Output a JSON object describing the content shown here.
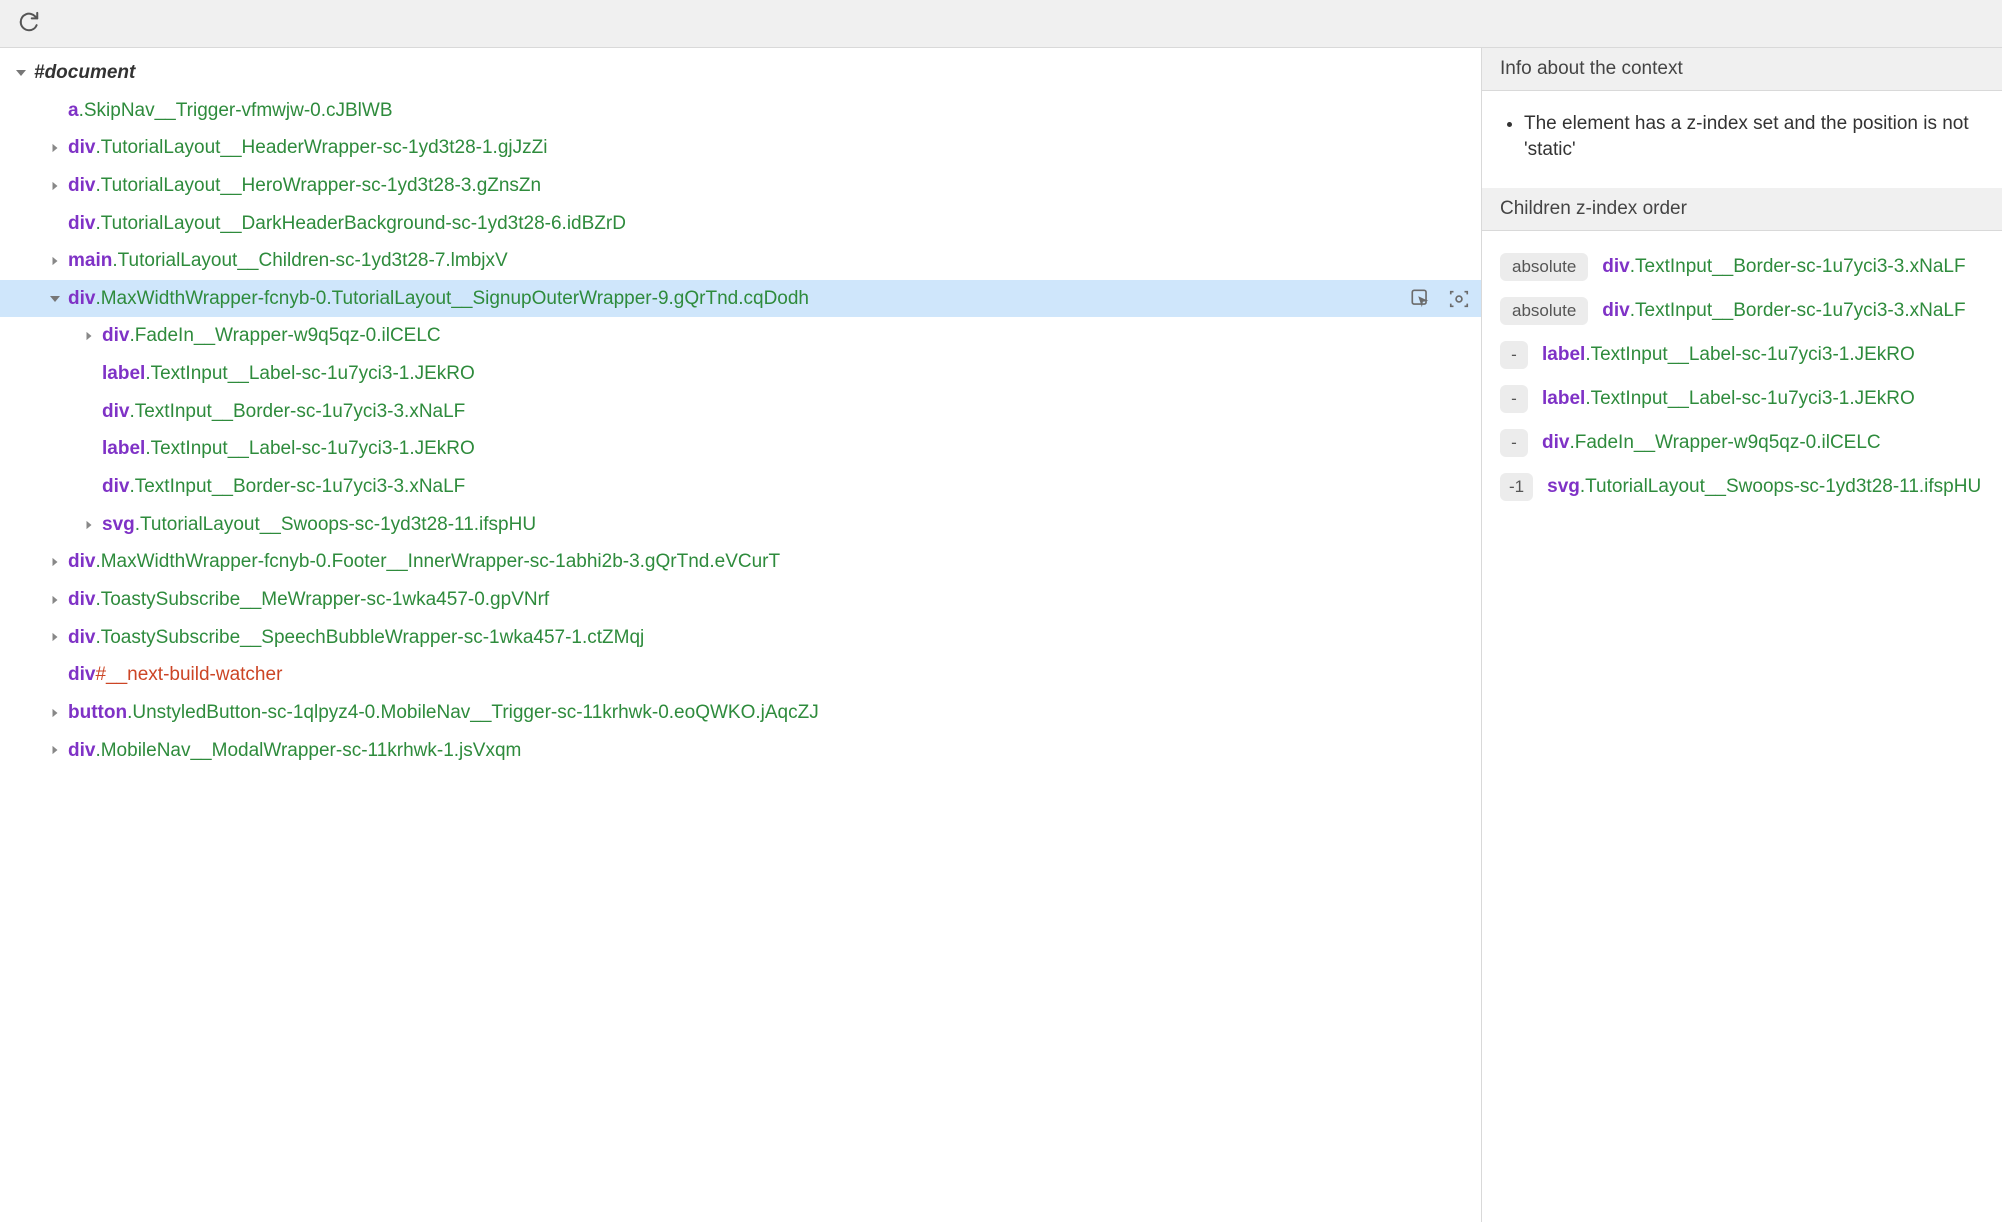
{
  "toolbar": {
    "reload_title": "Reload"
  },
  "tree": {
    "root": {
      "tag": "#document",
      "expanded": true
    },
    "nodes": [
      {
        "id": "a1",
        "depth": 1,
        "arrow": "none",
        "tag": "a",
        "cls": ".SkipNav__Trigger-vfmwjw-0.cJBlWB"
      },
      {
        "id": "d1",
        "depth": 1,
        "arrow": "closed",
        "tag": "div",
        "cls": ".TutorialLayout__HeaderWrapper-sc-1yd3t28-1.gjJzZi"
      },
      {
        "id": "d2",
        "depth": 1,
        "arrow": "closed",
        "tag": "div",
        "cls": ".TutorialLayout__HeroWrapper-sc-1yd3t28-3.gZnsZn"
      },
      {
        "id": "d3",
        "depth": 1,
        "arrow": "none",
        "tag": "div",
        "cls": ".TutorialLayout__DarkHeaderBackground-sc-1yd3t28-6.idBZrD"
      },
      {
        "id": "m1",
        "depth": 1,
        "arrow": "closed",
        "tag": "main",
        "cls": ".TutorialLayout__Children-sc-1yd3t28-7.lmbjxV"
      },
      {
        "id": "d4",
        "depth": 1,
        "arrow": "open",
        "tag": "div",
        "cls": ".MaxWidthWrapper-fcnyb-0.TutorialLayout__SignupOuterWrapper-9.gQrTnd.cqDodh",
        "selected": true
      },
      {
        "id": "d4a",
        "depth": 2,
        "arrow": "closed",
        "tag": "div",
        "cls": ".FadeIn__Wrapper-w9q5qz-0.ilCELC"
      },
      {
        "id": "d4b",
        "depth": 2,
        "arrow": "none",
        "tag": "label",
        "cls": ".TextInput__Label-sc-1u7yci3-1.JEkRO"
      },
      {
        "id": "d4c",
        "depth": 2,
        "arrow": "none",
        "tag": "div",
        "cls": ".TextInput__Border-sc-1u7yci3-3.xNaLF"
      },
      {
        "id": "d4d",
        "depth": 2,
        "arrow": "none",
        "tag": "label",
        "cls": ".TextInput__Label-sc-1u7yci3-1.JEkRO"
      },
      {
        "id": "d4e",
        "depth": 2,
        "arrow": "none",
        "tag": "div",
        "cls": ".TextInput__Border-sc-1u7yci3-3.xNaLF"
      },
      {
        "id": "d4f",
        "depth": 2,
        "arrow": "closed",
        "tag": "svg",
        "cls": ".TutorialLayout__Swoops-sc-1yd3t28-11.ifspHU"
      },
      {
        "id": "d5",
        "depth": 1,
        "arrow": "closed",
        "tag": "div",
        "cls": ".MaxWidthWrapper-fcnyb-0.Footer__InnerWrapper-sc-1abhi2b-3.gQrTnd.eVCurT"
      },
      {
        "id": "d6",
        "depth": 1,
        "arrow": "closed",
        "tag": "div",
        "cls": ".ToastySubscribe__MeWrapper-sc-1wka457-0.gpVNrf"
      },
      {
        "id": "d7",
        "depth": 1,
        "arrow": "closed",
        "tag": "div",
        "cls": ".ToastySubscribe__SpeechBubbleWrapper-sc-1wka457-1.ctZMqj"
      },
      {
        "id": "d8",
        "depth": 1,
        "arrow": "none",
        "tag": "div",
        "idsel": "#__next-build-watcher"
      },
      {
        "id": "b1",
        "depth": 1,
        "arrow": "closed",
        "tag": "button",
        "cls": ".UnstyledButton-sc-1qlpyz4-0.MobileNav__Trigger-sc-11krhwk-0.eoQWKO.jAqcZJ"
      },
      {
        "id": "d9",
        "depth": 1,
        "arrow": "closed",
        "tag": "div",
        "cls": ".MobileNav__ModalWrapper-sc-11krhwk-1.jsVxqm"
      }
    ]
  },
  "side": {
    "context_header": "Info about the context",
    "context_bullets": [
      "The element has a z-index set and the position is not 'static'"
    ],
    "zorder_header": "Children z-index order",
    "zchildren": [
      {
        "badge": "absolute",
        "tag": "div",
        "cls": ".TextInput__Border-sc-1u7yci3-3.xNaLF"
      },
      {
        "badge": "absolute",
        "tag": "div",
        "cls": ".TextInput__Border-sc-1u7yci3-3.xNaLF"
      },
      {
        "badge": "-",
        "tag": "label",
        "cls": ".TextInput__Label-sc-1u7yci3-1.JEkRO"
      },
      {
        "badge": "-",
        "tag": "label",
        "cls": ".TextInput__Label-sc-1u7yci3-1.JEkRO"
      },
      {
        "badge": "-",
        "tag": "div",
        "cls": ".FadeIn__Wrapper-w9q5qz-0.ilCELC"
      },
      {
        "badge": "-1",
        "tag": "svg",
        "cls": ".TutorialLayout__Swoops-sc-1yd3t28-11.ifspHU"
      }
    ]
  },
  "icons": {
    "inspect_title": "Inspect element",
    "screenshot_title": "Capture node screenshot"
  }
}
